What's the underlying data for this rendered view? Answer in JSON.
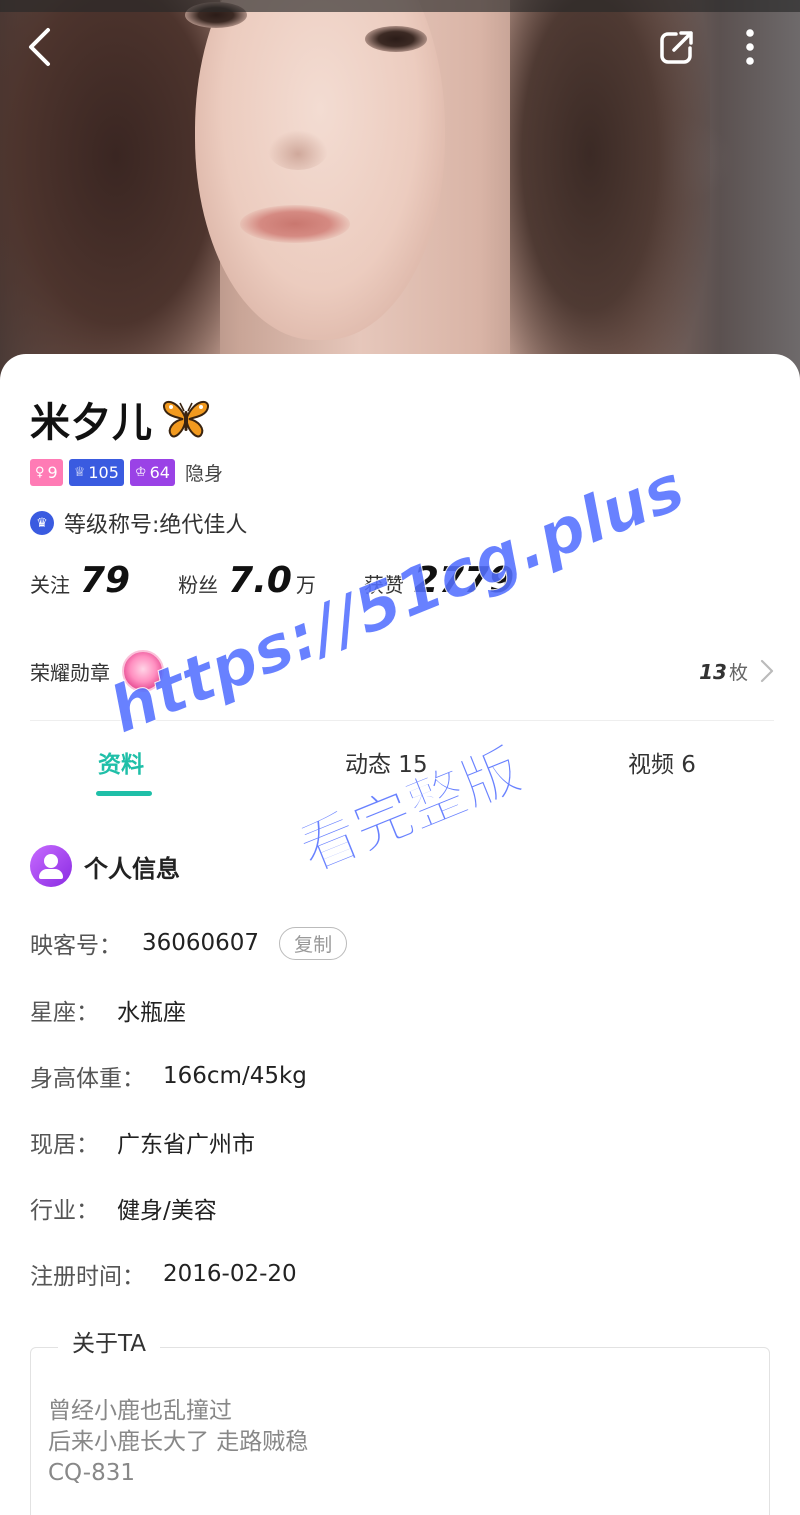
{
  "profile": {
    "name": "米夕儿",
    "badges": [
      {
        "glyph": "♀",
        "value": "9",
        "color": "#ff7bb5"
      },
      {
        "glyph": "♕",
        "value": "105",
        "color": "#3a5be0"
      },
      {
        "glyph": "♔",
        "value": "64",
        "color": "#9a42e6"
      }
    ],
    "stealth_label": "隐身",
    "title_text": "等级称号:绝代佳人",
    "stats": {
      "following_label": "关注",
      "following_value": "79",
      "fans_label": "粉丝",
      "fans_value": "7.0",
      "fans_unit": "万",
      "likes_label": "获赞",
      "likes_value": "2779"
    },
    "honor": {
      "label": "荣耀勋章",
      "count": "13",
      "count_unit": "枚"
    }
  },
  "tabs": [
    {
      "label": "资料",
      "active": true
    },
    {
      "label": "动态 15",
      "active": false
    },
    {
      "label": "视频 6",
      "active": false
    }
  ],
  "info": {
    "section_title": "个人信息",
    "copy_label": "复制",
    "rows": [
      {
        "key": "映客号：",
        "value": "36060607"
      },
      {
        "key": "星座：",
        "value": "水瓶座"
      },
      {
        "key": "身高体重：",
        "value": "166cm/45kg"
      },
      {
        "key": "现居：",
        "value": "广东省广州市"
      },
      {
        "key": "行业：",
        "value": "健身/美容"
      },
      {
        "key": "注册时间：",
        "value": "2016-02-20"
      }
    ]
  },
  "about": {
    "label": "关于TA",
    "lines": [
      "曾经小鹿也乱撞过",
      "后来小鹿长大了 走路贼稳",
      "CQ-831"
    ]
  },
  "watermark": {
    "url": "https://51cg.plus",
    "text": "看完整版"
  },
  "colors": {
    "accent": "#1fbfa8",
    "watermark": "#5470ff"
  }
}
